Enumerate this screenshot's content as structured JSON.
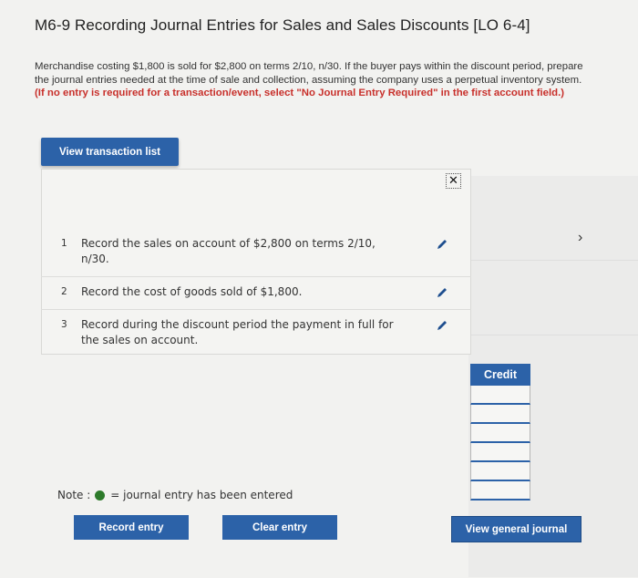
{
  "title": "M6-9 Recording Journal Entries for Sales and Sales Discounts [LO 6-4]",
  "instructions": {
    "body": "Merchandise costing $1,800 is sold for $2,800 on terms 2/10, n/30. If the buyer pays within the discount period, prepare the journal entries needed at the time of sale and collection, assuming the company uses a perpetual inventory system.",
    "emphasis": "(If no entry is required for a transaction/event, select \"No Journal Entry Required\" in the first account field.)"
  },
  "view_transaction_list_label": "View transaction list",
  "close_glyph": "✕",
  "transactions": [
    {
      "num": "1",
      "text": "Record the sales on account of $2,800 on terms 2/10, n/30."
    },
    {
      "num": "2",
      "text": "Record the cost of goods sold of $1,800."
    },
    {
      "num": "3",
      "text": "Record during the discount period the payment in full for the sales on account."
    }
  ],
  "credit_header": "Credit",
  "note": {
    "label": "Note :",
    "text": "= journal entry has been entered"
  },
  "buttons": {
    "record_entry": "Record entry",
    "clear_entry": "Clear entry",
    "view_general_journal": "View general journal"
  },
  "chevron_glyph": "›",
  "colors": {
    "accent_blue": "#2c62a8",
    "instruction_red": "#c8302b",
    "entered_green": "#2d7a2a",
    "pencil_blue": "#1f4f8f"
  },
  "icons": [
    "pencil-icon",
    "close-icon",
    "chevron-right-icon",
    "green-dot-icon"
  ]
}
